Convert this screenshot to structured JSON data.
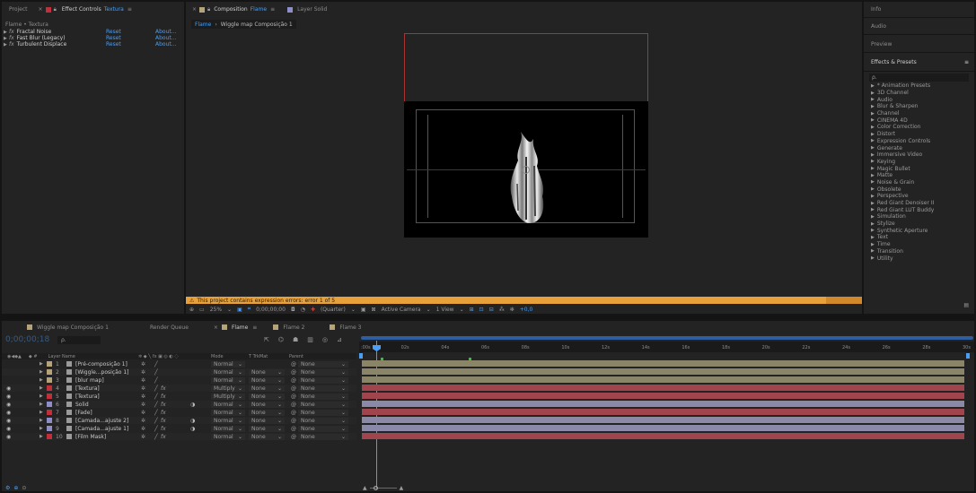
{
  "project_panel": {
    "tabs": [
      "Project",
      "Effect Controls",
      "Textura"
    ],
    "breadcrumb": "Flame • Textura",
    "effects": [
      {
        "name": "Fractal Noise",
        "reset": "Reset",
        "about": "About..."
      },
      {
        "name": "Fast Blur (Legacy)",
        "reset": "Reset",
        "about": "About..."
      },
      {
        "name": "Turbulent Displace",
        "reset": "Reset",
        "about": "About..."
      }
    ]
  },
  "composition": {
    "tab_label": "Composition",
    "tab_comp_name": "Flame",
    "layer_tab": "Layer Solid",
    "breadcrumbs": [
      "Flame",
      "Wiggle map Composição 1"
    ],
    "warning": "This project contains expression errors: error 1 of 5",
    "zoom": "25%",
    "timecode": "0;00;00;00",
    "resolution": "(Quarter)",
    "camera": "Active Camera",
    "view": "1 View",
    "exposure": "+0,0"
  },
  "right_panel": {
    "sections": [
      "Info",
      "Audio",
      "Preview"
    ],
    "effects_presets_title": "Effects & Presets",
    "search_placeholder": "ρ.",
    "categories": [
      "* Animation Presets",
      "3D Channel",
      "Audio",
      "Blur & Sharpen",
      "Channel",
      "CINEMA 4D",
      "Color Correction",
      "Distort",
      "Expression Controls",
      "Generate",
      "Immersive Video",
      "Keying",
      "Magic Bullet",
      "Matte",
      "Noise & Grain",
      "Obsolete",
      "Perspective",
      "Red Giant Denoiser II",
      "Red Giant LUT Buddy",
      "Simulation",
      "Stylize",
      "Synthetic Aperture",
      "Text",
      "Time",
      "Transition",
      "Utility"
    ]
  },
  "timeline": {
    "tabs": [
      "Wiggle map Composição 1",
      "Render Queue",
      "Flame",
      "Flame 2",
      "Flame 3"
    ],
    "timecode": "0;00;00;18",
    "search_placeholder": "ρ.",
    "headers": {
      "layer_name": "Layer Name",
      "mode": "Mode",
      "trkmat": "T TrkMat",
      "parent": "Parent"
    },
    "ticks": [
      ":00s",
      "02s",
      "04s",
      "06s",
      "08s",
      "10s",
      "12s",
      "14s",
      "16s",
      "18s",
      "20s",
      "22s",
      "24s",
      "26s",
      "28s",
      "30s"
    ],
    "layers": [
      {
        "num": "1",
        "name": "[Pré-composição 1]",
        "color": "#b5a47a",
        "mode": "Normal",
        "trkmat": "",
        "parent": "None",
        "fx": false,
        "eye": false,
        "bar": "#8a8468"
      },
      {
        "num": "2",
        "name": "[Wiggle...posição 1]",
        "color": "#b5a47a",
        "mode": "Normal",
        "trkmat": "None",
        "parent": "None",
        "fx": false,
        "eye": false,
        "bar": "#8a8468"
      },
      {
        "num": "3",
        "name": "[blur map]",
        "color": "#b5a47a",
        "mode": "Normal",
        "trkmat": "None",
        "parent": "None",
        "fx": false,
        "eye": false,
        "bar": "#8a8468"
      },
      {
        "num": "4",
        "name": "[Textura]",
        "color": "#c0303a",
        "mode": "Multiply",
        "trkmat": "None",
        "parent": "None",
        "fx": true,
        "eye": true,
        "bar": "#a0444d"
      },
      {
        "num": "5",
        "name": "[Textura]",
        "color": "#c0303a",
        "mode": "Multiply",
        "trkmat": "None",
        "parent": "None",
        "fx": true,
        "eye": true,
        "bar": "#a0444d"
      },
      {
        "num": "6",
        "name": "Solid",
        "color": "#8e8ec8",
        "mode": "Normal",
        "trkmat": "None",
        "parent": "None",
        "fx": true,
        "eye": true,
        "bar": "#8a8aa8"
      },
      {
        "num": "7",
        "name": "[Fade]",
        "color": "#c0303a",
        "mode": "Normal",
        "trkmat": "None",
        "parent": "None",
        "fx": true,
        "eye": true,
        "bar": "#a0444d"
      },
      {
        "num": "8",
        "name": "[Camada...ajuste 2]",
        "color": "#8e8ec8",
        "mode": "Normal",
        "trkmat": "None",
        "parent": "None",
        "fx": true,
        "eye": true,
        "bar": "#8a8aa8"
      },
      {
        "num": "9",
        "name": "[Camada...ajuste 1]",
        "color": "#8e8ec8",
        "mode": "Normal",
        "trkmat": "None",
        "parent": "None",
        "fx": true,
        "eye": true,
        "bar": "#8a8aa8"
      },
      {
        "num": "10",
        "name": "[Film Mask]",
        "color": "#c0303a",
        "mode": "Normal",
        "trkmat": "None",
        "parent": "None",
        "fx": true,
        "eye": true,
        "bar": "#a0444d"
      }
    ]
  },
  "colors": {
    "accent_blue": "#4a9ff5",
    "warning_orange": "#e8a13a"
  }
}
